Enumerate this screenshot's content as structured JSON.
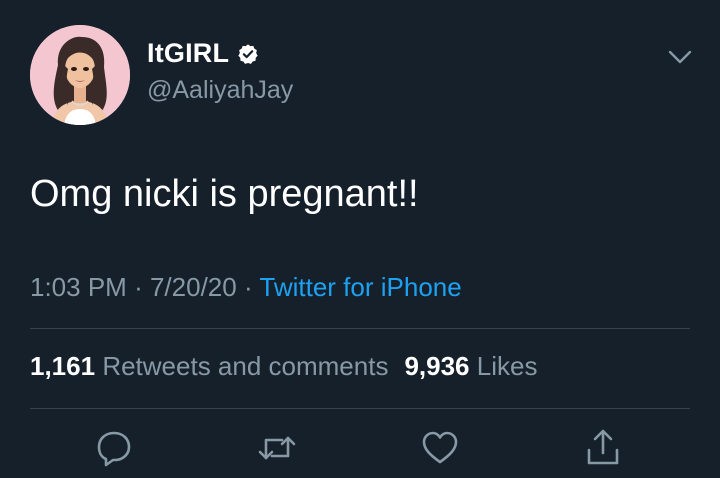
{
  "tweet": {
    "display_name": "ItGIRL",
    "handle": "@AaliyahJay",
    "text": "Omg nicki is pregnant!!",
    "time": "1:03 PM",
    "date": "7/20/20",
    "separator": "·",
    "source": "Twitter for iPhone",
    "verified": true
  },
  "stats": {
    "retweets_count": "1,161",
    "retweets_label": "Retweets and comments",
    "likes_count": "9,936",
    "likes_label": "Likes"
  },
  "icons": {
    "avatar": "avatar",
    "verified": "verified-badge-icon",
    "menu": "chevron-down-icon",
    "reply": "reply-icon",
    "retweet": "retweet-icon",
    "like": "heart-icon",
    "share": "share-icon"
  },
  "colors": {
    "background": "#15202b",
    "primary_text": "#ffffff",
    "secondary_text": "#8899a6",
    "link": "#1da1f2",
    "divider": "#38444d",
    "avatar_bg": "#f4c6cf"
  }
}
